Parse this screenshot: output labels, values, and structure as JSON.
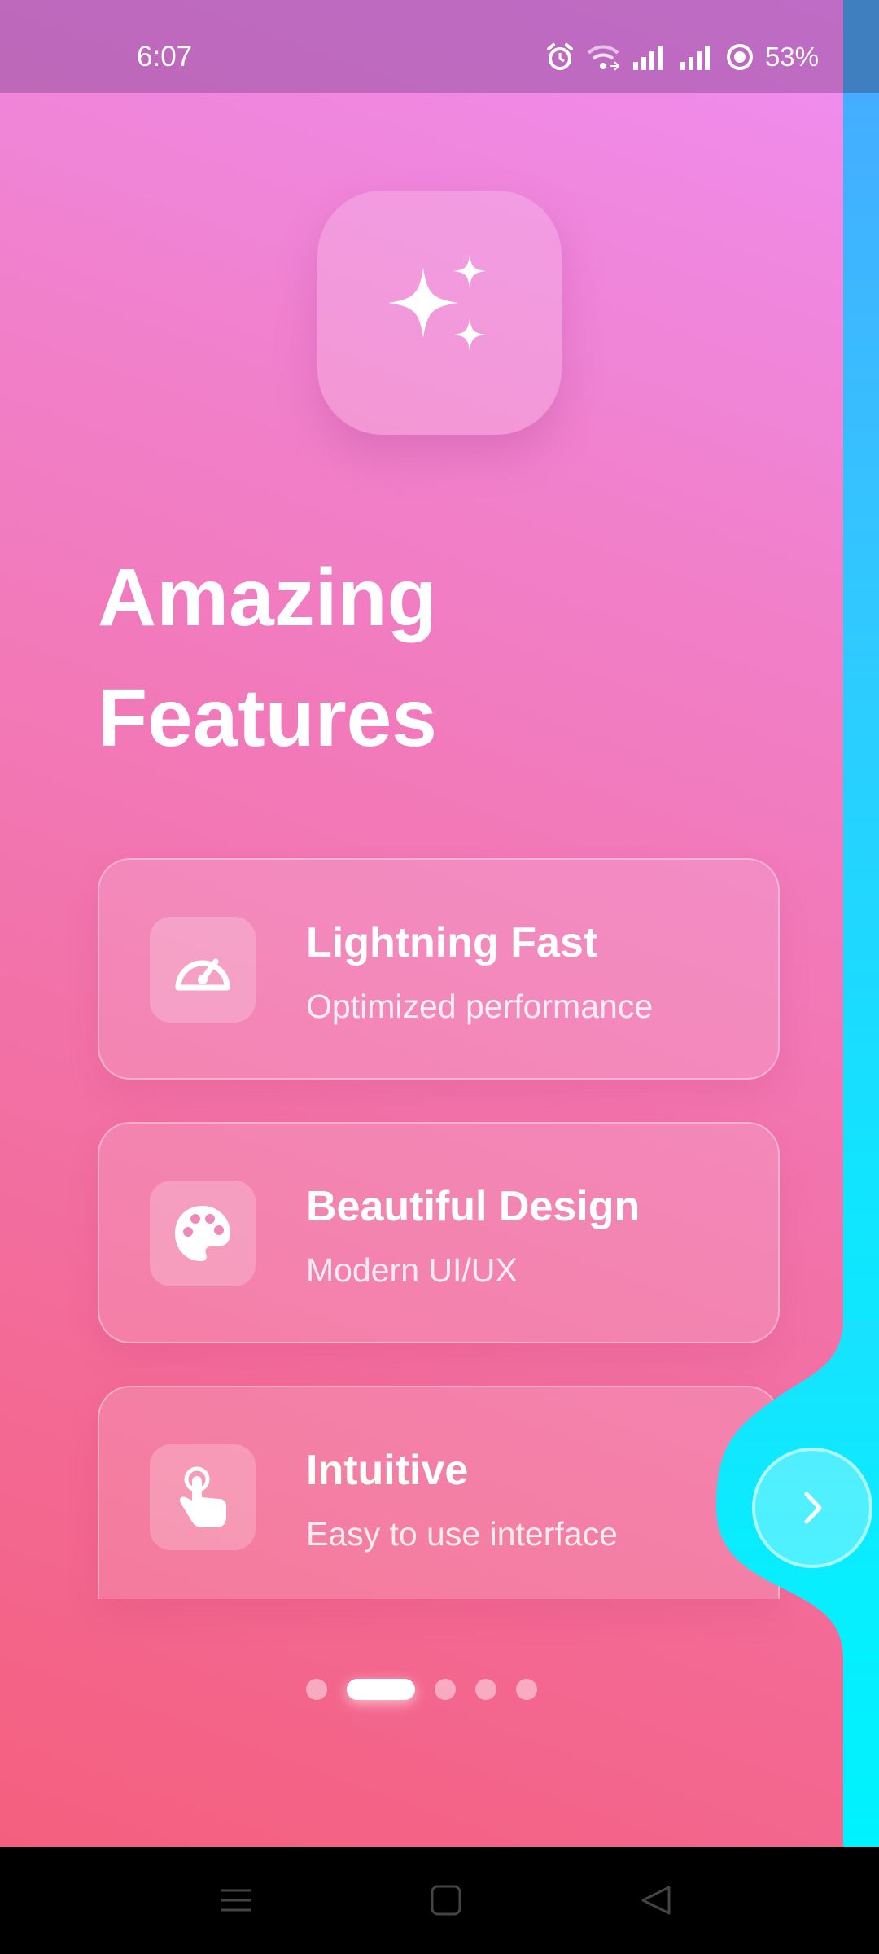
{
  "status_bar": {
    "time": "6:07",
    "battery": "53%",
    "icons": [
      "alarm-icon",
      "wifi-icon",
      "signal-icon",
      "signal-icon",
      "battery-icon"
    ]
  },
  "hero": {
    "icon": "sparkles-icon"
  },
  "title": "Amazing\nFeatures",
  "features": [
    {
      "icon": "speedometer-icon",
      "title": "Lightning Fast",
      "subtitle": "Optimized performance"
    },
    {
      "icon": "palette-icon",
      "title": "Beautiful Design",
      "subtitle": "Modern UI/UX"
    },
    {
      "icon": "tap-hand-icon",
      "title": "Intuitive",
      "subtitle": "Easy to use interface"
    }
  ],
  "pagination": {
    "total": 5,
    "active_index": 1
  },
  "next_button": {
    "icon": "chevron-right-icon"
  },
  "nav_bar": {
    "buttons": [
      "menu-icon",
      "home-icon",
      "back-icon"
    ]
  },
  "colors": {
    "gradient_top": "#ef8ef2",
    "gradient_bottom": "#f45f7e",
    "accent_cyan": "#00f2ff"
  }
}
